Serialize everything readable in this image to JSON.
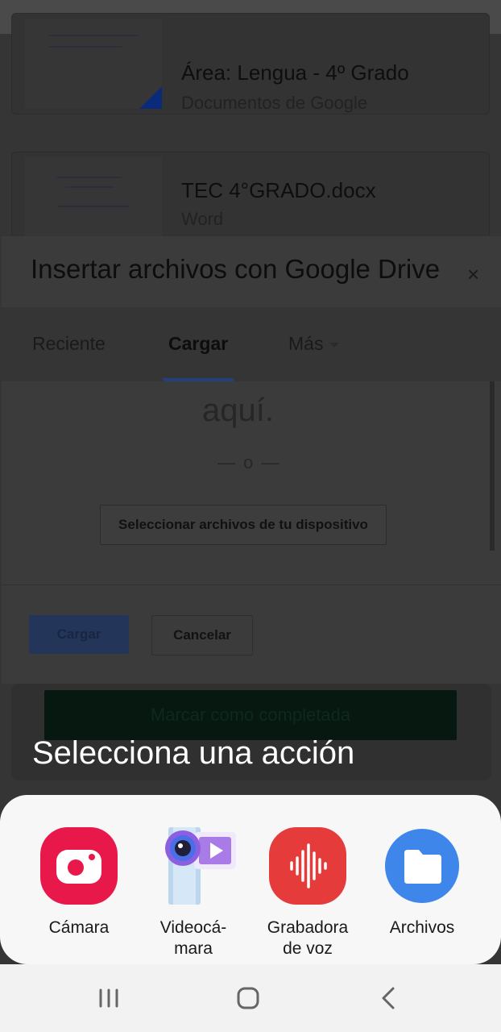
{
  "background_docs": [
    {
      "title": "Área: Lengua - 4º Grado",
      "subtitle": "Documentos de Google"
    },
    {
      "title": "TEC 4°GRADO.docx",
      "subtitle": "Word"
    }
  ],
  "dialog": {
    "title": "Insertar archivos con Google Drive",
    "close_glyph": "×",
    "tabs": [
      {
        "label": "Reciente"
      },
      {
        "label": "Cargar"
      },
      {
        "label": "Más"
      }
    ],
    "active_tab": "Cargar",
    "drop_text": "aquí.",
    "separator": "— o —",
    "select_button": "Seleccionar archivos de tu dispositivo",
    "upload_button": "Cargar",
    "cancel_button": "Cancelar"
  },
  "complete_button": "Marcar como completada",
  "action_sheet": {
    "title": "Selecciona una acción",
    "apps": [
      {
        "label": "Cámara",
        "icon": "camera-icon",
        "color": "#e8194a"
      },
      {
        "label": "Videocá-\nmara",
        "icon": "video-camera-icon",
        "color": "#9b6ff0"
      },
      {
        "label": "Grabadora\nde voz",
        "icon": "voice-recorder-icon",
        "color": "#e53b3b"
      },
      {
        "label": "Archivos",
        "icon": "files-icon",
        "color": "#3f86ea"
      }
    ]
  },
  "nav": {
    "recent_icon": "recent-apps-icon",
    "home_icon": "home-icon",
    "back_icon": "back-icon"
  }
}
